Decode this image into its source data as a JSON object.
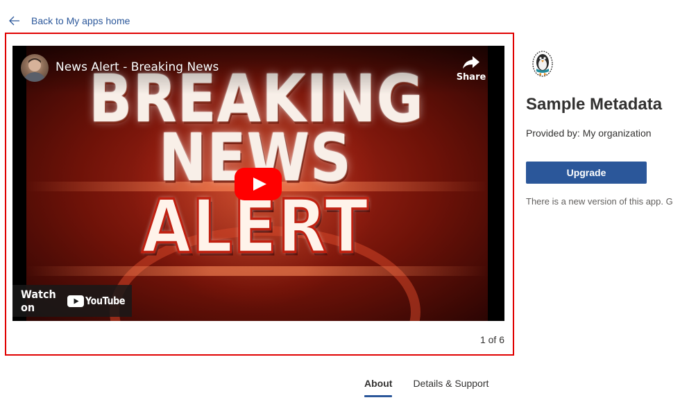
{
  "nav": {
    "back_label": "Back to My apps home",
    "back_icon": "arrow-left-icon"
  },
  "media": {
    "video": {
      "title": "News Alert - Breaking News",
      "share_label": "Share",
      "watch_on_label": "Watch on",
      "youtube_wordmark": "YouTube",
      "thumbnail_text": [
        "BREAKING",
        "NEWS",
        "ALERT"
      ]
    },
    "pager": "1 of 6"
  },
  "app": {
    "title": "Sample Metadata",
    "provided_by": "Provided by: My organization",
    "upgrade_label": "Upgrade",
    "new_version_notice": "There is a new version of this app. G"
  },
  "tabs": [
    {
      "label": "About",
      "active": true
    },
    {
      "label": "Details & Support",
      "active": false
    }
  ],
  "colors": {
    "accent": "#2b579a",
    "highlight_border": "#e00000",
    "play_red": "#ff0000"
  }
}
